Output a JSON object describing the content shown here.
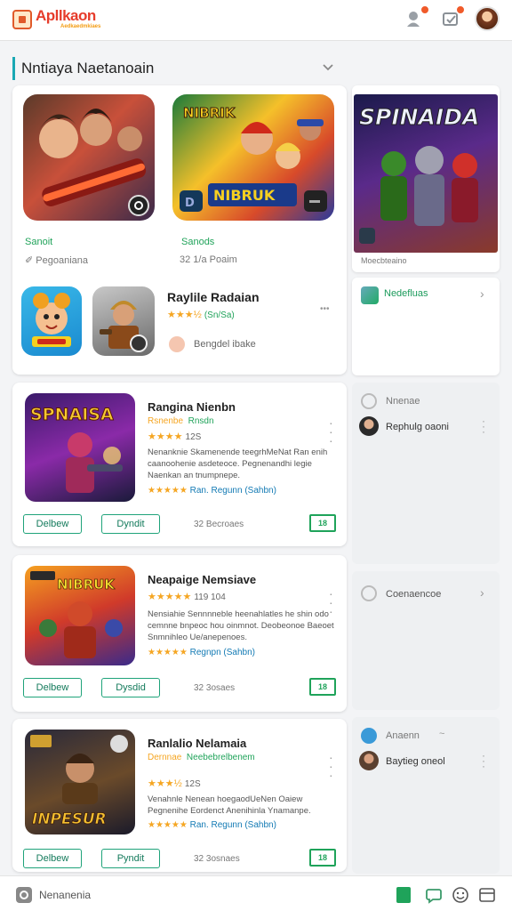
{
  "header": {
    "logo_text": "Apllkaon",
    "logo_sub": "Aedkaedmkiaes",
    "icons": [
      "notifications-icon",
      "messages-icon",
      "profile-avatar"
    ],
    "badge_color": "#f05a2a"
  },
  "section": {
    "title": "Nntiaya  Naetanoain"
  },
  "featured": {
    "game1": {
      "label": "Sanoit",
      "meta": "Pegoaniana"
    },
    "game2": {
      "label": "Sanods",
      "meta": "32 1/a Poaim"
    },
    "banner_word": "NIBRUK",
    "game3": {
      "title": "Raylile Radaian",
      "stars": "★★★½",
      "rating": "(Sn/Sa)",
      "more": "•••",
      "note": "Bengdel ibake"
    }
  },
  "right": {
    "top_art_title": "SPINAIDA",
    "top_caption": "Moecbteaino",
    "row1_label": "Nedefluas",
    "panel1": {
      "title": "Nnenae",
      "row": "Rephulg oaoni"
    },
    "panel2": {
      "title": "Coenaencoe"
    },
    "panel3": {
      "title": "Anaenn",
      "tilde": "~",
      "row": "Baytieg oneol"
    }
  },
  "apps": [
    {
      "title": "Rangina Nienbn",
      "sub_a": "Rsnenbe",
      "sub_b": "Rnsdn",
      "stars": "★★★★",
      "rating": "12S",
      "desc": "Nenanknie Skamenende teegrhMeNat Ran enih caanoohenie asdeteoce. Pegnenandhi legie Naenkan an tnumpnepe.",
      "stars2": "★★★★★",
      "rating_link": "Ran. Regunn (Sahbn)",
      "btn1": "Delbew",
      "btn2": "Dyndit",
      "count": "32 Becroaes",
      "box": "18",
      "art": "SPNAISA"
    },
    {
      "title": "Neapaige Nemsiave",
      "sub_a": "",
      "sub_b": "",
      "stars": "★★★★★",
      "rating": "119 104",
      "desc": "Nensiahie Sennnneble heenahlatles he shin odo cemnne bnpeoc hou oinmnot. Deobeonoe Baeoet Snmnihleo Ue/anepenoes.",
      "stars2": "★★★★★",
      "rating_link": "Regnpn (Sahbn)",
      "btn1": "Delbew",
      "btn2": "Dysdid",
      "count": "32 3osaes",
      "box": "18",
      "art": "NIBRUK"
    },
    {
      "title": "Ranlalio Nelamaia",
      "sub_a": "Dernnae",
      "sub_b": "Neebebrelbenem",
      "stars": "★★★½",
      "rating": "12S",
      "desc": "Venahnle Nenean hoegaodUeNen Oaiew Pegnenihe Eordenct Anenihinla Ynamanpe.",
      "stars2": "★★★★★",
      "rating_link": "Ran. Regunn (Sahbn)",
      "btn1": "Delbew",
      "btn2": "Pyndit",
      "count": "32 3osnaes",
      "box": "18",
      "art": "INPESUR"
    }
  ],
  "bottom": {
    "label": "Nenanenia"
  }
}
